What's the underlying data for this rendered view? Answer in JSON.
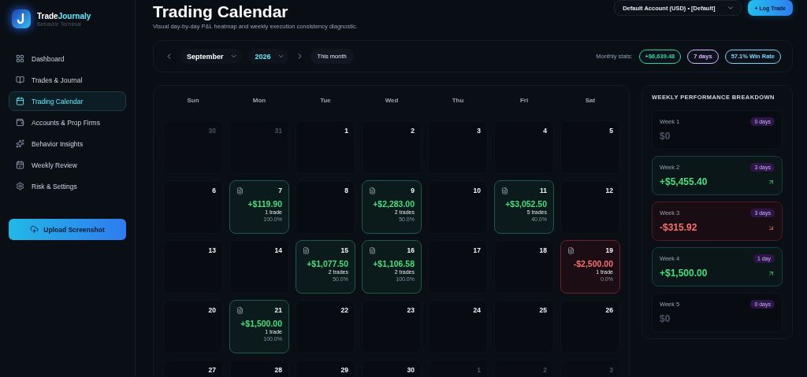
{
  "brand": {
    "name_lead": "Trade",
    "name_accent": "Journaly",
    "tagline": "Behavior Terminal"
  },
  "sidebar": {
    "items": [
      {
        "label": "Dashboard",
        "selected": false
      },
      {
        "label": "Trades & Journal",
        "selected": false
      },
      {
        "label": "Trading Calendar",
        "selected": true
      },
      {
        "label": "Accounts & Prop Firms",
        "selected": false
      },
      {
        "label": "Behavior Insights",
        "selected": false
      },
      {
        "label": "Weekly Review",
        "selected": false
      },
      {
        "label": "Risk & Settings",
        "selected": false
      }
    ],
    "upload_button": "Upload Screenshot"
  },
  "header": {
    "title": "Trading Calendar",
    "subtitle": "Visual day-by-day P&L heatmap and weekly execution consistency diagnostic.",
    "account": "Default Account (USD) • [Default]",
    "log_button": "+ Log Trade"
  },
  "toolbar": {
    "month": "September",
    "year": "2026",
    "this_month": "This month",
    "stats_label": "Monthly stats:",
    "stats": [
      {
        "text": "+$6,639.48",
        "color": "#34d399"
      },
      {
        "text": "7 days",
        "color": "#d8b4fe"
      },
      {
        "text": "57.1% Win Rate",
        "color": "#7dd3fc"
      }
    ]
  },
  "calendar": {
    "weekdays": [
      "Sun",
      "Mon",
      "Tue",
      "Wed",
      "Thu",
      "Fri",
      "Sat"
    ],
    "days": [
      {
        "day": "30",
        "kind": "outside"
      },
      {
        "day": "31",
        "kind": "outside"
      },
      {
        "day": "1",
        "kind": "empty"
      },
      {
        "day": "2",
        "kind": "empty"
      },
      {
        "day": "3",
        "kind": "empty"
      },
      {
        "day": "4",
        "kind": "empty"
      },
      {
        "day": "5",
        "kind": "empty"
      },
      {
        "day": "6",
        "kind": "empty"
      },
      {
        "day": "7",
        "kind": "win",
        "pnl": "+$119.90",
        "trades": "1 trade",
        "rate": "100.0%"
      },
      {
        "day": "8",
        "kind": "empty"
      },
      {
        "day": "9",
        "kind": "win",
        "pnl": "+$2,283.00",
        "trades": "2 trades",
        "rate": "50.0%"
      },
      {
        "day": "10",
        "kind": "empty"
      },
      {
        "day": "11",
        "kind": "win",
        "pnl": "+$3,052.50",
        "trades": "5 trades",
        "rate": "40.0%"
      },
      {
        "day": "12",
        "kind": "empty"
      },
      {
        "day": "13",
        "kind": "empty"
      },
      {
        "day": "14",
        "kind": "empty"
      },
      {
        "day": "15",
        "kind": "win",
        "pnl": "+$1,077.50",
        "trades": "2 trades",
        "rate": "50.0%"
      },
      {
        "day": "16",
        "kind": "win",
        "pnl": "+$1,106.58",
        "trades": "2 trades",
        "rate": "100.0%"
      },
      {
        "day": "17",
        "kind": "empty"
      },
      {
        "day": "18",
        "kind": "empty"
      },
      {
        "day": "19",
        "kind": "loss",
        "pnl": "-$2,500.00",
        "trades": "1 trade",
        "rate": "0.0%"
      },
      {
        "day": "20",
        "kind": "empty"
      },
      {
        "day": "21",
        "kind": "win",
        "pnl": "+$1,500.00",
        "trades": "1 trade",
        "rate": "100.0%"
      },
      {
        "day": "22",
        "kind": "empty"
      },
      {
        "day": "23",
        "kind": "empty"
      },
      {
        "day": "24",
        "kind": "empty"
      },
      {
        "day": "25",
        "kind": "empty"
      },
      {
        "day": "26",
        "kind": "empty"
      },
      {
        "day": "27",
        "kind": "empty"
      },
      {
        "day": "28",
        "kind": "empty"
      },
      {
        "day": "29",
        "kind": "empty"
      },
      {
        "day": "30",
        "kind": "empty"
      },
      {
        "day": "1",
        "kind": "outside"
      },
      {
        "day": "2",
        "kind": "outside"
      },
      {
        "day": "3",
        "kind": "outside"
      }
    ]
  },
  "weekly": {
    "title": "WEEKLY PERFORMANCE BREAKDOWN",
    "weeks": [
      {
        "label": "Week 1",
        "days": "0 days",
        "value": "$0",
        "kind": "neutral"
      },
      {
        "label": "Week 2",
        "days": "3 days",
        "value": "+$5,455.40",
        "kind": "win"
      },
      {
        "label": "Week 3",
        "days": "3 days",
        "value": "-$315.92",
        "kind": "loss"
      },
      {
        "label": "Week 4",
        "days": "1 day",
        "value": "+$1,500.00",
        "kind": "win"
      },
      {
        "label": "Week 5",
        "days": "0 days",
        "value": "$0",
        "kind": "neutral"
      }
    ]
  }
}
